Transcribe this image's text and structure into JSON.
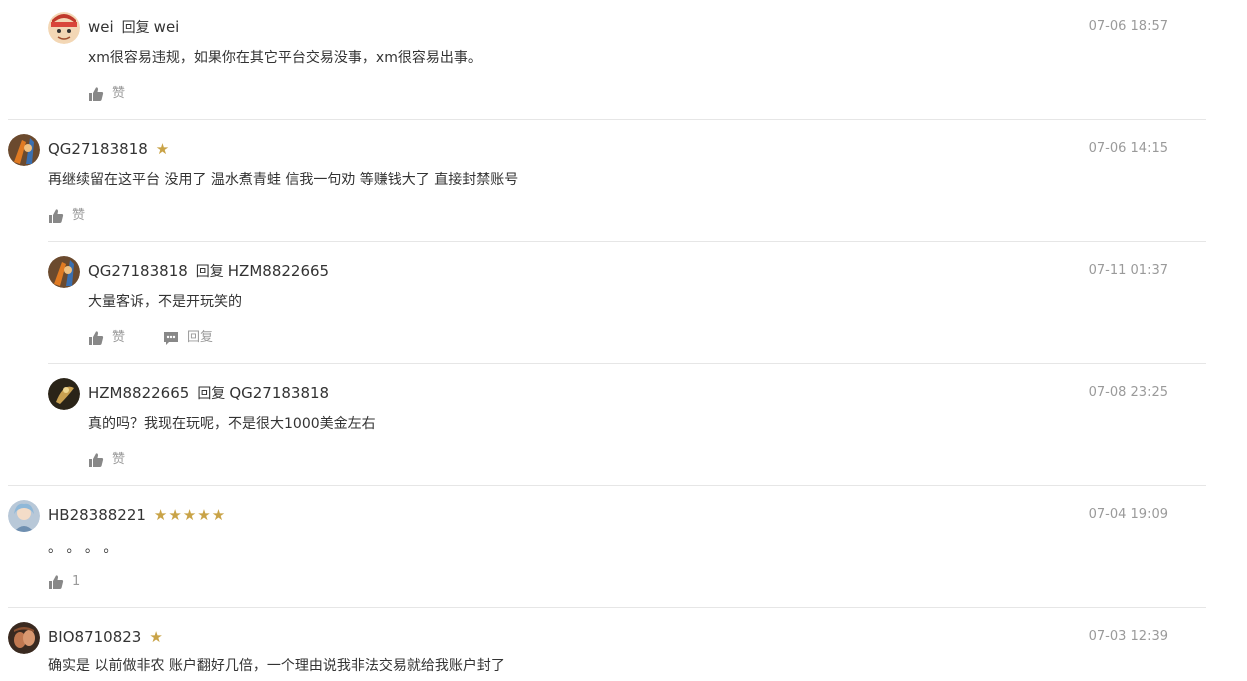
{
  "comments": [
    {
      "username": "wei",
      "reply_label": "回复",
      "reply_to": "wei",
      "time": "07-06 18:57",
      "text": "xm很容易违规，如果你在其它平台交易没事，xm很容易出事。",
      "like_label": "赞"
    },
    {
      "username": "QG27183818",
      "stars": "★",
      "time": "07-06 14:15",
      "text": "再继续留在这平台 没用了 温水煮青蛙 信我一句劝 等赚钱大了 直接封禁账号",
      "like_label": "赞"
    },
    {
      "username": "QG27183818",
      "reply_label": "回复",
      "reply_to": "HZM8822665",
      "time": "07-11 01:37",
      "text": "大量客诉，不是开玩笑的",
      "like_label": "赞",
      "reply_action_label": "回复"
    },
    {
      "username": "HZM8822665",
      "reply_label": "回复",
      "reply_to": "QG27183818",
      "time": "07-08 23:25",
      "text": "真的吗？我现在玩呢，不是很大1000美金左右",
      "like_label": "赞"
    },
    {
      "username": "HB28388221",
      "stars": "★★★★★",
      "time": "07-04 19:09",
      "text": "。 。 。 。",
      "like_label": "1"
    },
    {
      "username": "BIO8710823",
      "stars": "★",
      "time": "07-03 12:39",
      "text": "确实是 以前做非农 账户翻好几倍，一个理由说我非法交易就给我账户封了"
    }
  ],
  "icons": {
    "like": "thumbs-up-icon",
    "reply": "chat-bubble-icon"
  },
  "colors": {
    "star": "#c9a347",
    "muted": "#9a9a9a",
    "text": "#333333",
    "divider": "#e6e6e6"
  }
}
